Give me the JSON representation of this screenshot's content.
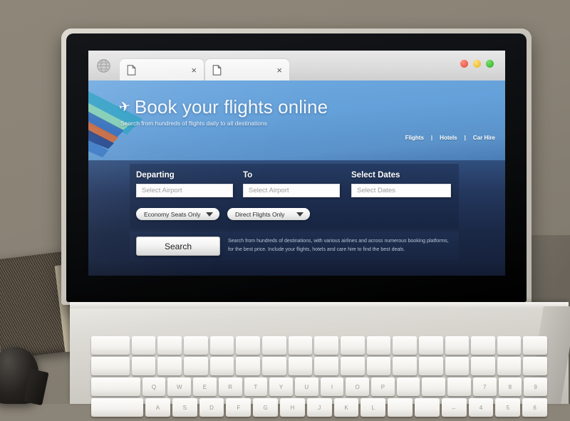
{
  "browser": {
    "globe_icon": "globe-icon",
    "tabs": [
      {
        "icon": "document-icon",
        "close": "×"
      },
      {
        "icon": "document-icon",
        "close": "×"
      }
    ],
    "window_buttons": [
      {
        "name": "close",
        "color": "#e8483a"
      },
      {
        "name": "minimize",
        "color": "#e3b224"
      },
      {
        "name": "maximize",
        "color": "#23ab21"
      }
    ]
  },
  "site": {
    "nav": [
      "Flights",
      "Hotels",
      "Car Hire"
    ],
    "plane_glyph": "✈",
    "title": "Book your flights online",
    "subtitle": "Search from hundreds of flights daily to all destinations"
  },
  "form": {
    "departing": {
      "label": "Departing",
      "placeholder": "Select Airport",
      "value": ""
    },
    "to": {
      "label": "To",
      "placeholder": "Select Airport",
      "value": ""
    },
    "dates": {
      "label": "Select Dates",
      "placeholder": "Select Dates",
      "value": ""
    },
    "dropdowns": [
      {
        "name": "cabin-class",
        "value": "Economy Seats Only"
      },
      {
        "name": "flight-type",
        "value": "Direct Flights Only"
      }
    ],
    "search_label": "Search",
    "blurb": "Search from hundreds of destinations, with various airlines and across numerous booking platforms, for the best price. Include your flights, hotels and care hire to find the best deals."
  },
  "keyboard": {
    "row3": [
      "",
      "Q",
      "W",
      "E",
      "R",
      "T",
      "Y",
      "U",
      "I",
      "O",
      "P",
      "",
      "",
      "",
      "7",
      "8",
      "9"
    ],
    "row4": [
      "",
      "A",
      "S",
      "D",
      "F",
      "G",
      "H",
      "J",
      "K",
      "L",
      "",
      "",
      "←",
      "4",
      "5",
      "6"
    ]
  },
  "colors": {
    "accent_sky": "#6fa9e0",
    "panel_navy": "#1c2c4e",
    "desk": "#8b8478",
    "pencil": "#3fc8a3"
  }
}
